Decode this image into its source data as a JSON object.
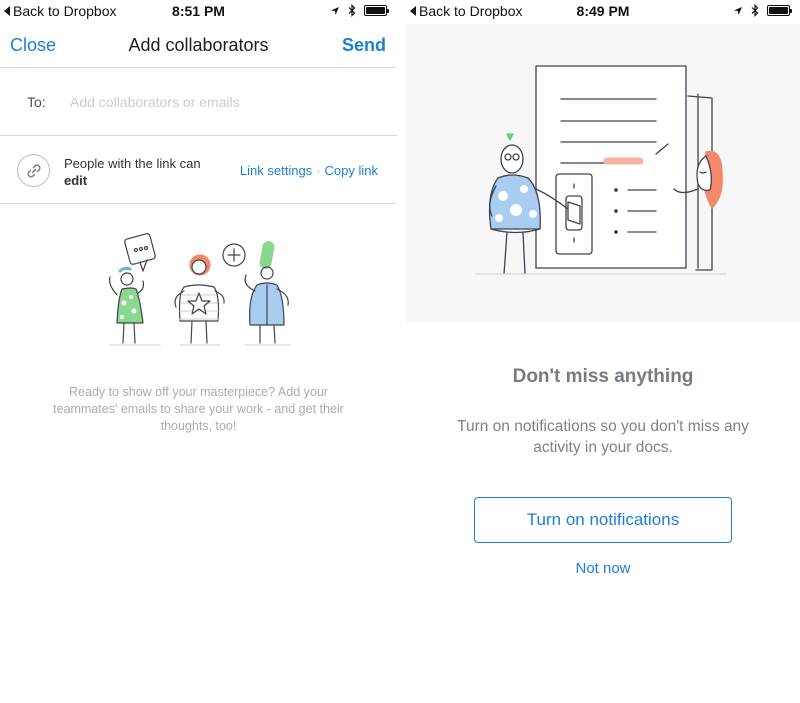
{
  "colors": {
    "accent": "#1b7fd9",
    "divider": "#d7dbe0",
    "muted_text": "#a7acb2",
    "green": "#7ed48a",
    "blue_dots": "#a9cdf0",
    "orange": "#f2896a"
  },
  "left": {
    "status": {
      "back_label": "Back to Dropbox",
      "time": "8:51 PM"
    },
    "nav": {
      "close_label": "Close",
      "title": "Add collaborators",
      "send_label": "Send"
    },
    "to_row": {
      "label": "To:",
      "placeholder": "Add collaborators or emails",
      "value": ""
    },
    "link_row": {
      "icon": "link-icon",
      "line1": "People with the link can",
      "line2": "edit",
      "settings_label": "Link settings",
      "separator": "·",
      "copy_label": "Copy link"
    },
    "empty_state": {
      "message": "Ready to show off your masterpiece? Add your teammates' emails to share your work - and get their thoughts, too!"
    }
  },
  "right": {
    "status": {
      "back_label": "Back to Dropbox",
      "time": "8:49 PM"
    },
    "title": "Don't miss anything",
    "description": "Turn on notifications so you don't miss any activity in your docs.",
    "primary_button": "Turn on notifications",
    "secondary_button": "Not now"
  },
  "status_icons": [
    "location-arrow-icon",
    "bluetooth-icon",
    "battery-icon"
  ]
}
